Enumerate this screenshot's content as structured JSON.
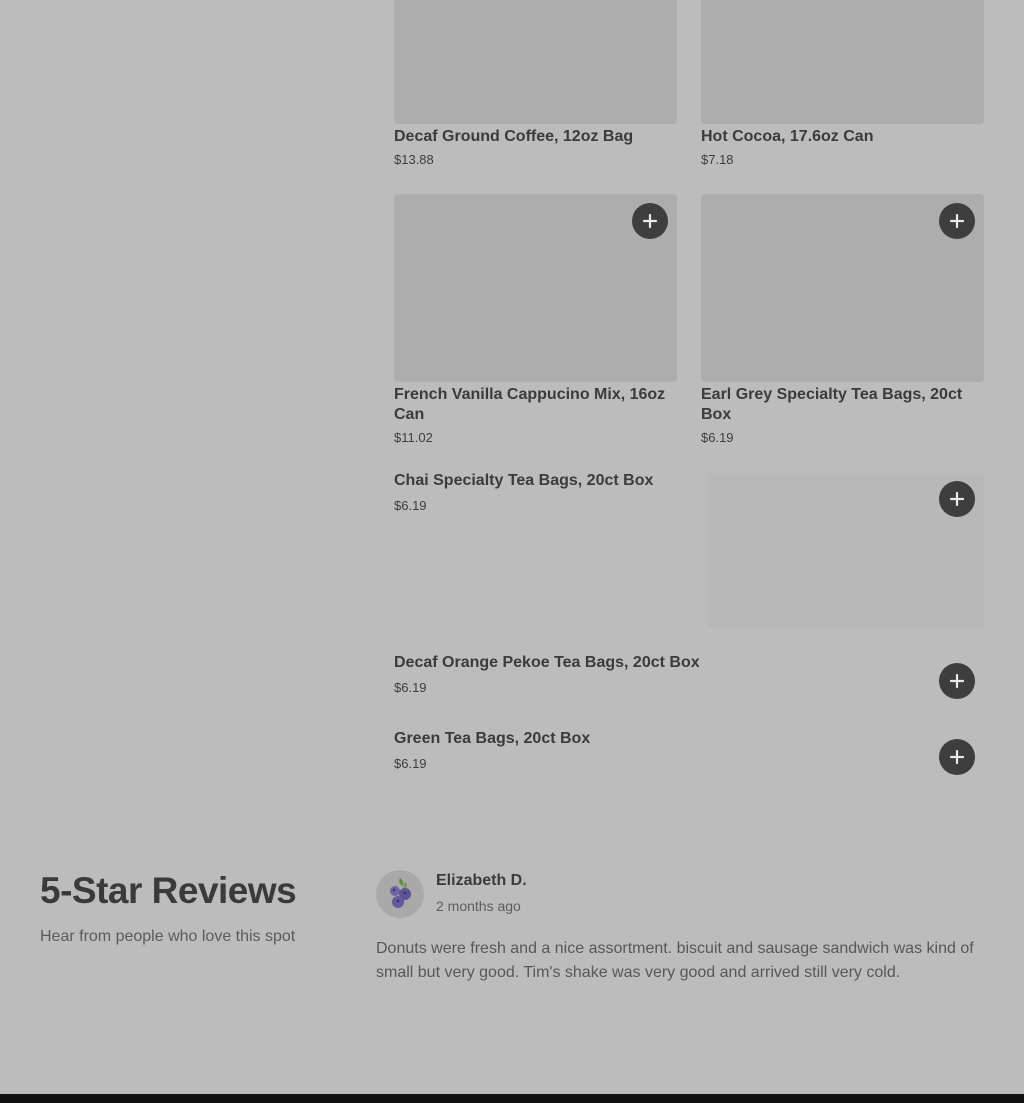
{
  "products": [
    {
      "title": "Decaf Ground Coffee, 12oz Bag",
      "price": "$13.88"
    },
    {
      "title": "Hot Cocoa, 17.6oz Can",
      "price": "$7.18"
    },
    {
      "title": "French Vanilla Cappucino Mix, 16oz Can",
      "price": "$11.02"
    },
    {
      "title": "Earl Grey Specialty Tea Bags, 20ct Box",
      "price": "$6.19"
    },
    {
      "title": "Chai Specialty Tea Bags, 20ct Box",
      "price": "$6.19"
    },
    {
      "title": "Decaf Orange Pekoe Tea Bags, 20ct Box",
      "price": "$6.19"
    },
    {
      "title": "Green Tea Bags, 20ct Box",
      "price": "$6.19"
    }
  ],
  "reviews": {
    "heading": "5-Star Reviews",
    "subheading": "Hear from people who love this spot",
    "items": [
      {
        "name": "Elizabeth D.",
        "time": "2 months ago",
        "text": "Donuts were fresh and a nice assortment. biscuit and sausage sandwich was kind of small but very good. Tim's shake was very good and arrived still very cold.",
        "avatar_icon": "blueberry-icon"
      }
    ]
  },
  "icons": {
    "add": "plus-icon"
  },
  "colors": {
    "overlay_bg": "#bcbcbc",
    "button_bg": "#3e3e3e"
  }
}
